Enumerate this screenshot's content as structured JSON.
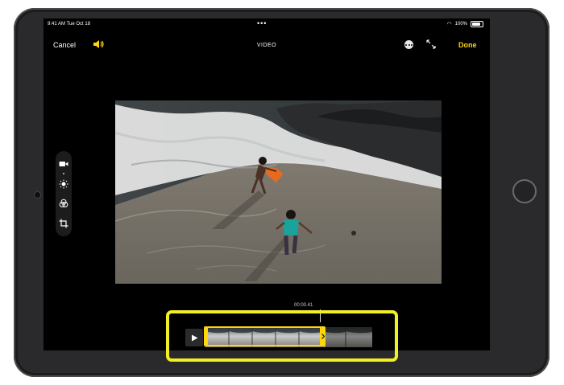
{
  "status_bar": {
    "time": "9:41 AM  Tue Oct 18",
    "battery": "100%"
  },
  "header": {
    "cancel_label": "Cancel",
    "title": "VIDEO",
    "done_label": "Done"
  },
  "timeline": {
    "timecode": "00:00.41"
  },
  "colors": {
    "accent": "#ffd60a",
    "highlight": "#f2ef23"
  },
  "icons": {
    "sound": "speaker-wave-icon",
    "more": "ellipsis-circle-icon",
    "aspect": "expand-arrows-icon",
    "tools": [
      "video-camera-icon",
      "adjust-brightness-icon",
      "filters-icon",
      "crop-rotate-icon"
    ],
    "play": "play-icon"
  }
}
